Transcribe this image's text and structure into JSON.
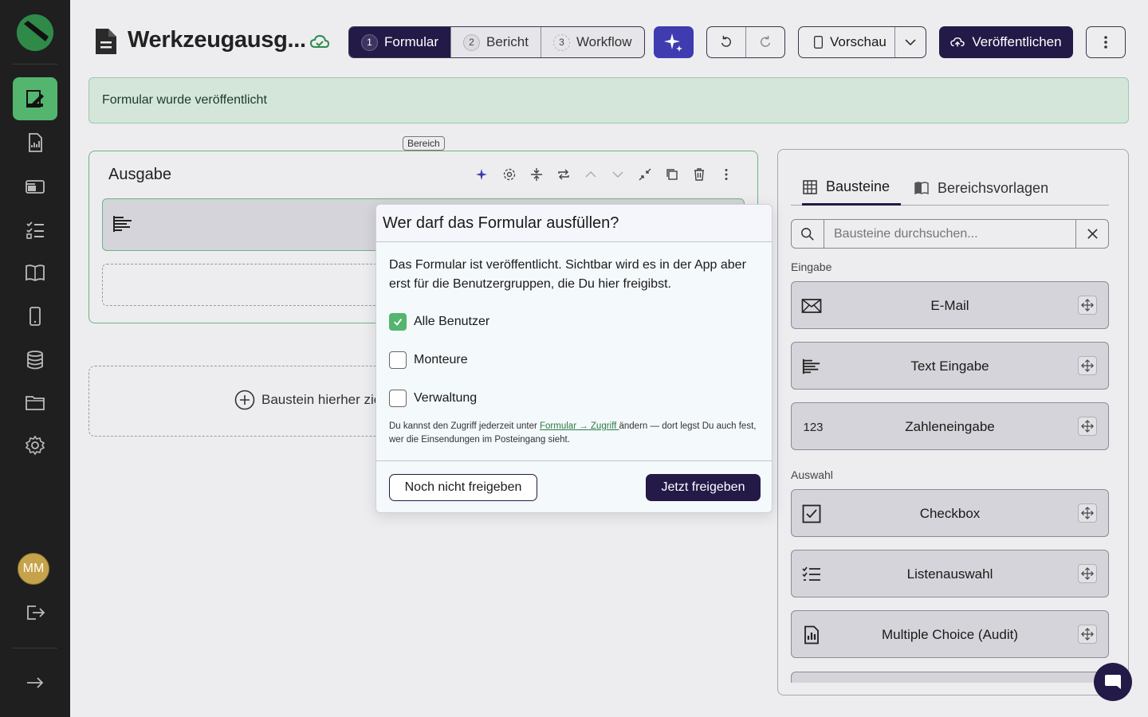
{
  "sidebar": {
    "items": [
      {
        "icon": "form-edit-icon",
        "active": true
      },
      {
        "icon": "report-icon",
        "active": false
      },
      {
        "icon": "inbox-icon",
        "active": false
      },
      {
        "icon": "checklist-icon",
        "active": false
      },
      {
        "icon": "book-icon",
        "active": false
      },
      {
        "icon": "mobile-icon",
        "active": false
      },
      {
        "icon": "database-icon",
        "active": false
      },
      {
        "icon": "folder-icon",
        "active": false
      },
      {
        "icon": "gear-icon",
        "active": false
      }
    ],
    "avatar_initials": "MM"
  },
  "header": {
    "title": "Werkzeugausg...",
    "steps": [
      {
        "num": "1",
        "label": "Formular"
      },
      {
        "num": "2",
        "label": "Bericht"
      },
      {
        "num": "3",
        "label": "Workflow"
      }
    ],
    "preview_label": "Vorschau",
    "publish_label": "Veröffentlichen"
  },
  "banner": {
    "text": "Formular wurde veröffentlicht"
  },
  "editor": {
    "section_tag": "Bereich",
    "section_title": "Ausgabe",
    "dropzone_label": "Baustein hierher zie"
  },
  "panel": {
    "tabs": [
      {
        "label": "Bausteine",
        "icon": "blocks-icon"
      },
      {
        "label": "Bereichsvorlagen",
        "icon": "templates-icon"
      }
    ],
    "search_placeholder": "Bausteine durchsuchen...",
    "groups": [
      {
        "label": "Eingabe",
        "items": [
          {
            "label": "E-Mail",
            "icon": "mail-icon"
          },
          {
            "label": "Text Eingabe",
            "icon": "text-input-icon"
          },
          {
            "label": "Zahleneingabe",
            "icon_text": "123"
          }
        ]
      },
      {
        "label": "Auswahl",
        "items": [
          {
            "label": "Checkbox",
            "icon": "checkbox-icon"
          },
          {
            "label": "Listenauswahl",
            "icon": "list-icon"
          },
          {
            "label": "Multiple Choice (Audit)",
            "icon": "audit-icon"
          }
        ]
      }
    ]
  },
  "modal": {
    "title": "Wer darf das Formular ausfüllen?",
    "description": "Das Formular ist veröffentlicht. Sichtbar wird es in der App aber erst für die Benutzergruppen, die Du hier freigibst.",
    "options": [
      {
        "label": "Alle Benutzer",
        "checked": true
      },
      {
        "label": "Monteure",
        "checked": false
      },
      {
        "label": "Verwaltung",
        "checked": false
      }
    ],
    "note_before": "Du kannst den Zugriff jederzeit unter ",
    "note_link": "Formular → Zugriff ",
    "note_after": "ändern — dort legst Du auch fest, wer die Einsendungen im Posteingang sieht.",
    "secondary_button": "Noch nicht freigeben",
    "primary_button": "Jetzt freigeben"
  },
  "colors": {
    "brand_dark": "#231a47",
    "accent_green": "#54b56e",
    "ai_blue": "#3f3bb0"
  }
}
